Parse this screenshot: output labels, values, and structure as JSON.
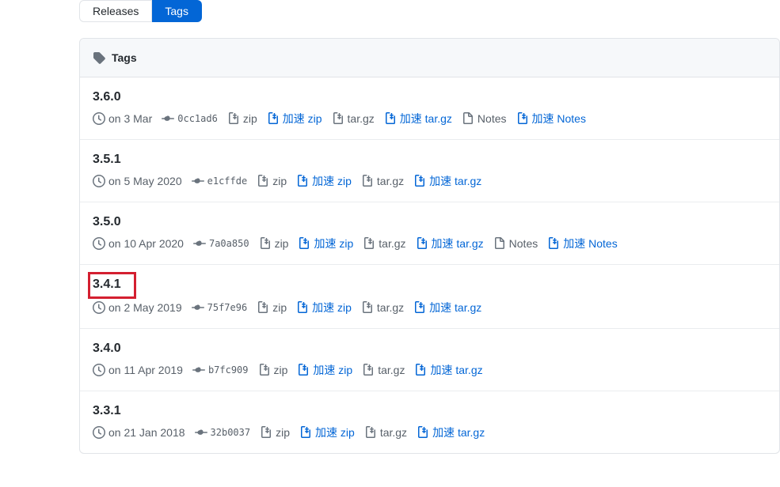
{
  "nav": {
    "releases": "Releases",
    "tags": "Tags"
  },
  "header": {
    "title": "Tags"
  },
  "labels": {
    "zip": "zip",
    "zip_cn": "加速 zip",
    "targz": "tar.gz",
    "targz_cn": "加速 tar.gz",
    "notes": "Notes",
    "notes_cn": "加速 Notes"
  },
  "tags": [
    {
      "version": "3.6.0",
      "date": "on 3 Mar",
      "commit": "0cc1ad6",
      "has_notes": true,
      "highlighted": false
    },
    {
      "version": "3.5.1",
      "date": "on 5 May 2020",
      "commit": "e1cffde",
      "has_notes": false,
      "highlighted": false
    },
    {
      "version": "3.5.0",
      "date": "on 10 Apr 2020",
      "commit": "7a0a850",
      "has_notes": true,
      "highlighted": false
    },
    {
      "version": "3.4.1",
      "date": "on 2 May 2019",
      "commit": "75f7e96",
      "has_notes": false,
      "highlighted": true
    },
    {
      "version": "3.4.0",
      "date": "on 11 Apr 2019",
      "commit": "b7fc909",
      "has_notes": false,
      "highlighted": false
    },
    {
      "version": "3.3.1",
      "date": "on 21 Jan 2018",
      "commit": "32b0037",
      "has_notes": false,
      "highlighted": false
    }
  ]
}
